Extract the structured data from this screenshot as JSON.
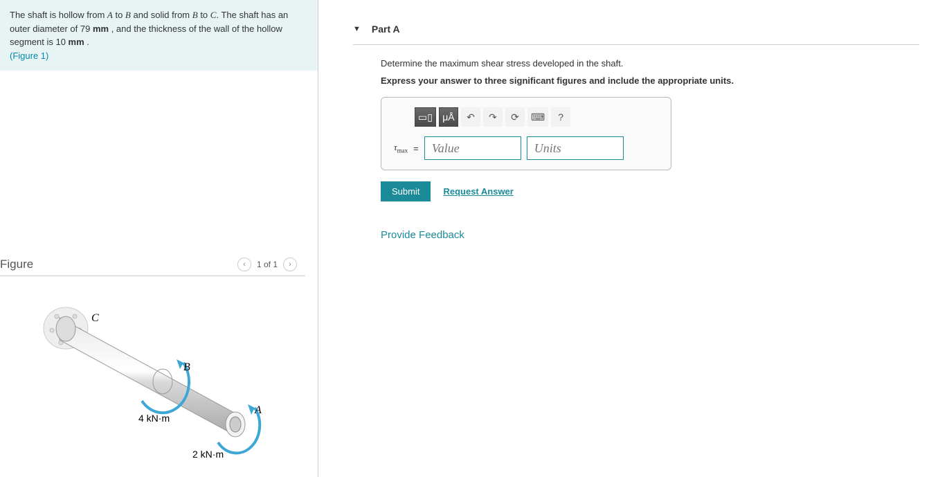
{
  "problem": {
    "text_pre": "The shaft is hollow from ",
    "A": "A",
    "to1": " to ",
    "B": "B",
    "mid": " and solid from ",
    "B2": "B",
    "to2": " to ",
    "C": "C",
    "post1": ". The shaft has an outer diameter of 79 ",
    "unit_mm1": "mm",
    "post2": " , and the thickness of the wall of the hollow segment is 10 ",
    "unit_mm2": "mm",
    "post3": " .",
    "figure_ref": "(Figure 1)"
  },
  "figure": {
    "title": "Figure",
    "counter": "1 of 1",
    "labels": {
      "C": "C",
      "B": "B",
      "A": "A",
      "torque_B": "4 kN·m",
      "torque_A": "2 kN·m"
    }
  },
  "part": {
    "title": "Part A",
    "prompt": "Determine the maximum shear stress developed in the shaft.",
    "instruction": "Express your answer to three significant figures and include the appropriate units.",
    "toolbar": {
      "templates": "▭▯",
      "micro": "μÅ",
      "undo": "↶",
      "redo": "↷",
      "reset": "⟳",
      "keyboard": "⌨",
      "help": "?"
    },
    "var_symbol": "τ",
    "var_sub": "max",
    "equals": "=",
    "value_placeholder": "Value",
    "units_placeholder": "Units",
    "submit": "Submit",
    "request": "Request Answer"
  },
  "feedback": "Provide Feedback"
}
